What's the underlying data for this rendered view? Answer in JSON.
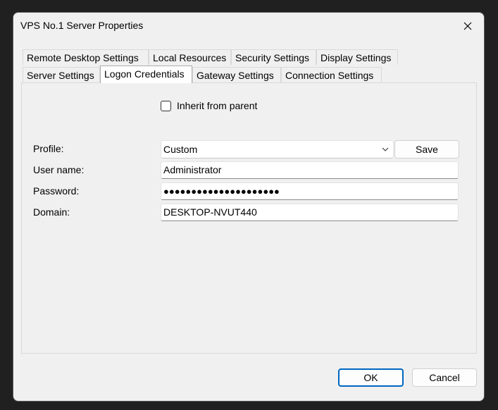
{
  "window": {
    "title": "VPS No.1 Server Properties"
  },
  "tabs_row1": [
    {
      "label": "Remote Desktop Settings"
    },
    {
      "label": "Local Resources"
    },
    {
      "label": "Security Settings"
    },
    {
      "label": "Display Settings"
    }
  ],
  "tabs_row2": [
    {
      "label": "Server Settings"
    },
    {
      "label": "Logon Credentials",
      "active": true
    },
    {
      "label": "Gateway Settings"
    },
    {
      "label": "Connection Settings"
    }
  ],
  "inherit": {
    "label": "Inherit from parent",
    "checked": false
  },
  "form": {
    "profile_label": "Profile:",
    "profile_value": "Custom",
    "save_label": "Save",
    "username_label": "User name:",
    "username_value": "Administrator",
    "password_label": "Password:",
    "password_value": "●●●●●●●●●●●●●●●●●●●●●",
    "domain_label": "Domain:",
    "domain_value": "DESKTOP-NVUT440"
  },
  "footer": {
    "ok_label": "OK",
    "cancel_label": "Cancel"
  },
  "icons": {
    "close": "close-icon",
    "dropdown": "chevron-down-icon"
  }
}
